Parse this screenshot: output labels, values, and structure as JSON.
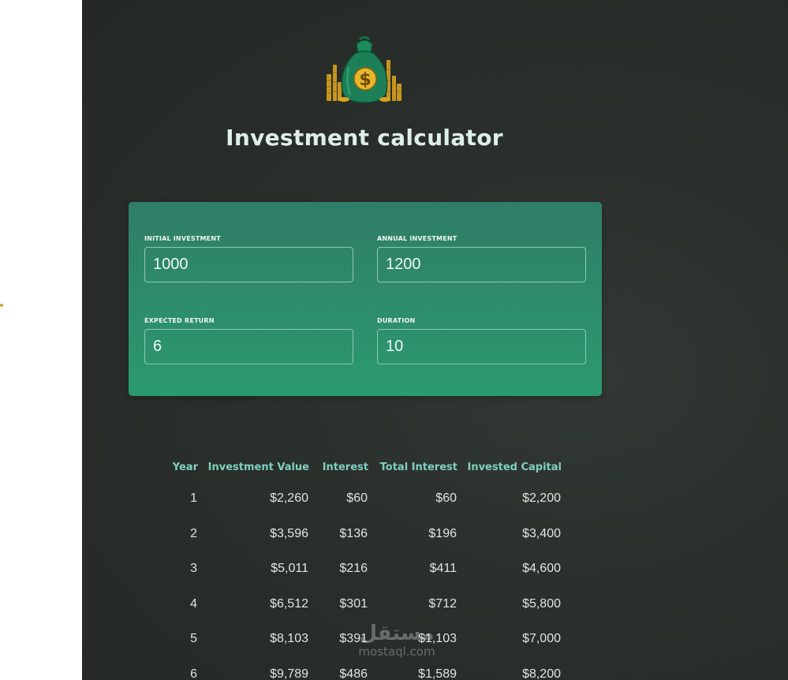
{
  "app": {
    "title": "Investment calculator",
    "logo_icon": "money-bag-dollar-icon"
  },
  "inputs": {
    "initial_investment": {
      "label": "INITIAL INVESTMENT",
      "value": "1000"
    },
    "annual_investment": {
      "label": "ANNUAL INVESTMENT",
      "value": "1200"
    },
    "expected_return": {
      "label": "EXPECTED RETURN",
      "value": "6"
    },
    "duration": {
      "label": "DURATION",
      "value": "10"
    }
  },
  "table": {
    "headers": [
      "Year",
      "Investment Value",
      "Interest",
      "Total Interest",
      "Invested Capital"
    ],
    "rows": [
      [
        "1",
        "$2,260",
        "$60",
        "$60",
        "$2,200"
      ],
      [
        "2",
        "$3,596",
        "$136",
        "$196",
        "$3,400"
      ],
      [
        "3",
        "$5,011",
        "$216",
        "$411",
        "$4,600"
      ],
      [
        "4",
        "$6,512",
        "$301",
        "$712",
        "$5,800"
      ],
      [
        "5",
        "$8,103",
        "$391",
        "$1,103",
        "$7,000"
      ],
      [
        "6",
        "$9,789",
        "$486",
        "$1,589",
        "$8,200"
      ]
    ]
  },
  "watermark": {
    "arabic": "مستقل",
    "latin": "mostaql.com"
  },
  "colors": {
    "background": "#2a2f2c",
    "card_top": "#307d68",
    "card_bottom": "#2b9a6e",
    "header_text": "#7fd0bf",
    "title_text": "#dfeee6"
  }
}
